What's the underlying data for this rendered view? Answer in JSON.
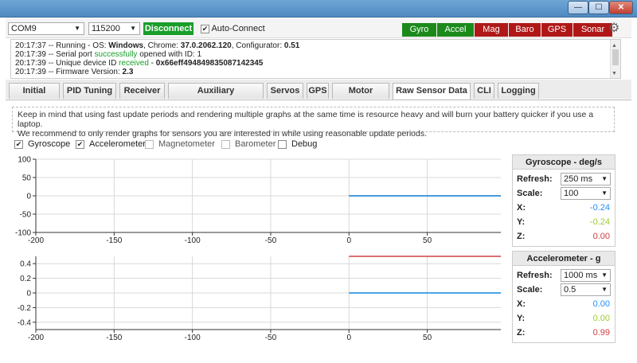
{
  "window": {
    "minimize": "—",
    "maximize": "☐",
    "close": "✕"
  },
  "topbar": {
    "port": "COM9",
    "baud": "115200",
    "disconnect_label": "Disconnect",
    "auto_connect_label": "Auto-Connect",
    "auto_connect_checked": true,
    "sensors": [
      {
        "label": "Gyro",
        "color": "#1b8a1b"
      },
      {
        "label": "Accel",
        "color": "#1b8a1b"
      },
      {
        "label": "Mag",
        "color": "#b01818"
      },
      {
        "label": "Baro",
        "color": "#b01818"
      },
      {
        "label": "GPS",
        "color": "#b01818"
      },
      {
        "label": "Sonar",
        "color": "#b01818"
      }
    ],
    "settings_icon": "gear-icon"
  },
  "log": {
    "lines": [
      {
        "time": "20:17:37",
        "prefix": " -- Running - OS: ",
        "os": "Windows",
        "mid": ", Chrome: ",
        "chrome": "37.0.2062.120",
        "mid2": ", Configurator: ",
        "configurator": "0.51"
      },
      {
        "time": "20:17:39",
        "prefix": " -- Serial port ",
        "status": "successfully",
        "suffix": " opened with ID: 1"
      },
      {
        "time": "20:17:39",
        "prefix": " -- Unique device ID ",
        "status": "received",
        "suffix": " - ",
        "device_id": "0x66eff494849835087142345"
      },
      {
        "time": "20:17:39",
        "prefix": " -- Firmware Version: ",
        "firmware": "2.3"
      }
    ]
  },
  "tabs": [
    {
      "label": "Initial Setup"
    },
    {
      "label": "PID Tuning"
    },
    {
      "label": "Receiver"
    },
    {
      "label": "Auxiliary Configuration"
    },
    {
      "label": "Servos"
    },
    {
      "label": "GPS"
    },
    {
      "label": "Motor Testing"
    },
    {
      "label": "Raw Sensor Data",
      "active": true
    },
    {
      "label": "CLI"
    },
    {
      "label": "Logging"
    }
  ],
  "note": {
    "line1": "Keep in mind that using fast update periods and rendering multiple graphs at the same time is resource heavy and will burn your battery quicker if you use a laptop.",
    "line2": "We recommend to only render graphs for sensors you are interested in while using reasonable update periods."
  },
  "graph_toggles": [
    {
      "label": "Gyroscope",
      "checked": true,
      "enabled": true
    },
    {
      "label": "Accelerometer",
      "checked": true,
      "enabled": true
    },
    {
      "label": "Magnetometer",
      "checked": false,
      "enabled": false
    },
    {
      "label": "Barometer",
      "checked": false,
      "enabled": false
    },
    {
      "label": "Debug",
      "checked": false,
      "enabled": true
    }
  ],
  "chart_data": [
    {
      "type": "line",
      "y_ticks": [
        "100",
        "50",
        "0",
        "-50",
        "-100"
      ],
      "x_ticks": [
        "-200",
        "-150",
        "-100",
        "-50",
        "0",
        "50"
      ],
      "xlim": [
        -200,
        97
      ],
      "ylim": [
        -100,
        100
      ],
      "grid": true,
      "series": [
        {
          "color": "#e05a5a",
          "x": [
            0,
            97
          ],
          "y": [
            0,
            0
          ]
        },
        {
          "color": "#9acd32",
          "x": [
            0,
            97
          ],
          "y": [
            0,
            0
          ]
        },
        {
          "color": "#1e90ff",
          "x": [
            0,
            97
          ],
          "y": [
            0,
            0
          ]
        }
      ]
    },
    {
      "type": "line",
      "y_ticks": [
        "0.4",
        "0.2",
        "0",
        "-0.2",
        "-0.4"
      ],
      "x_ticks": [
        "-200",
        "-150",
        "-100",
        "-50",
        "0",
        "50"
      ],
      "xlim": [
        -200,
        97
      ],
      "ylim": [
        -0.5,
        0.5
      ],
      "grid": true,
      "series": [
        {
          "color": "#d04040",
          "x": [
            0,
            97
          ],
          "y": [
            0.99,
            0.99
          ]
        },
        {
          "color": "#9acd32",
          "x": [
            0,
            97
          ],
          "y": [
            0,
            0
          ]
        },
        {
          "color": "#1e90ff",
          "x": [
            0,
            97
          ],
          "y": [
            0,
            0
          ]
        }
      ]
    }
  ],
  "gyro_panel": {
    "title": "Gyroscope - deg/s",
    "refresh_label": "Refresh:",
    "refresh_value": "250 ms",
    "scale_label": "Scale:",
    "scale_value": "100",
    "x_label": "X:",
    "x_value": "-0.24",
    "x_color": "#1e90ff",
    "y_label": "Y:",
    "y_value": "-0.24",
    "y_color": "#9acd32",
    "z_label": "Z:",
    "z_value": "0.00",
    "z_color": "#d04040"
  },
  "accel_panel": {
    "title": "Accelerometer - g",
    "refresh_label": "Refresh:",
    "refresh_value": "1000 ms",
    "scale_label": "Scale:",
    "scale_value": "0.5",
    "x_label": "X:",
    "x_value": "0.00",
    "x_color": "#1e90ff",
    "y_label": "Y:",
    "y_value": "0.00",
    "y_color": "#9acd32",
    "z_label": "Z:",
    "z_value": "0.99",
    "z_color": "#d04040"
  }
}
